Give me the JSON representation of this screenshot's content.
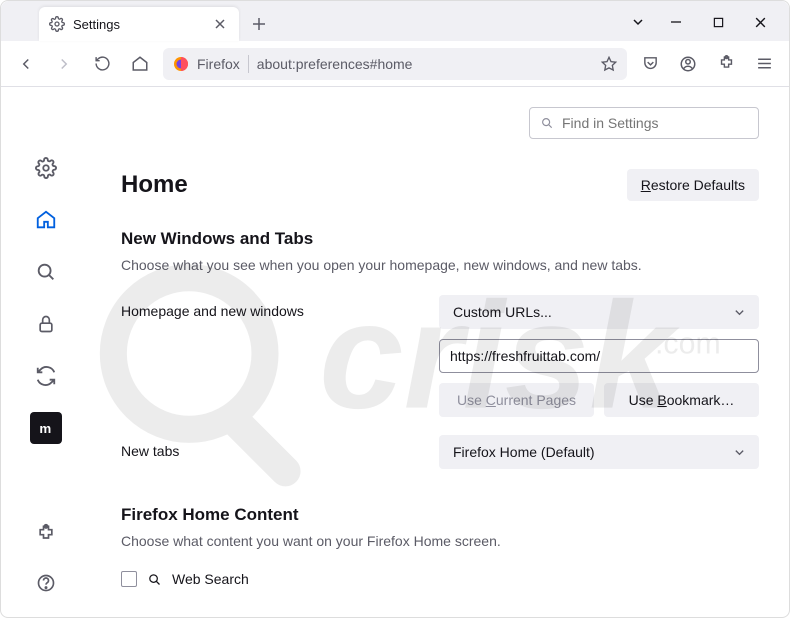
{
  "tab": {
    "title": "Settings"
  },
  "address": {
    "brand": "Firefox",
    "url": "about:preferences#home"
  },
  "search": {
    "placeholder": "Find in Settings"
  },
  "page": {
    "title": "Home",
    "restore_label": "Restore Defaults",
    "section1_title": "New Windows and Tabs",
    "section1_desc": "Choose what you see when you open your homepage, new windows, and new tabs.",
    "homepage_dropdown": "Custom URLs...",
    "homepage_label": "Homepage and new windows",
    "homepage_value": "https://freshfruittab.com/",
    "use_current": "Use Current Pages",
    "use_bookmark": "Use Bookmark…",
    "newtabs_label": "New tabs",
    "newtabs_dropdown": "Firefox Home (Default)",
    "section2_title": "Firefox Home Content",
    "section2_desc": "Choose what content you want on your Firefox Home screen.",
    "websearch_label": "Web Search"
  }
}
